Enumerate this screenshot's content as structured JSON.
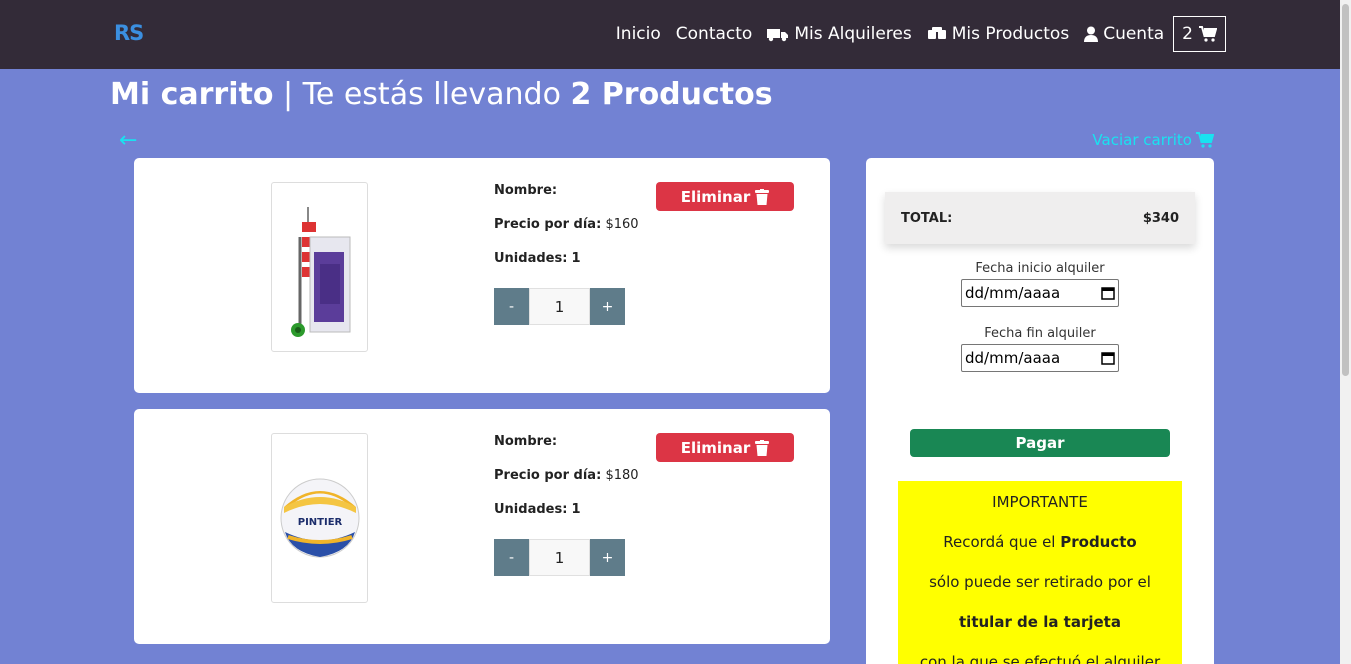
{
  "nav": {
    "brand": "RS",
    "links": [
      "Inicio",
      "Contacto",
      "Mis Alquileres",
      "Mis Productos",
      "Cuenta"
    ],
    "cart_count": "2"
  },
  "title": {
    "main": "Mi carrito",
    "separator": " | ",
    "middle": "Te estás llevando ",
    "count": "2 Productos"
  },
  "clear_cart_label": "Vaciar carrito",
  "back_arrow": "←",
  "labels": {
    "name": "Nombre:",
    "price": "Precio por día:",
    "units": "Unidades:",
    "delete": "Eliminar",
    "minus": "-",
    "plus": "+"
  },
  "items": [
    {
      "name": "",
      "price": "$160",
      "units": "1",
      "qty": "1",
      "image": "beach-cart-icon"
    },
    {
      "name": "",
      "price": "$180",
      "units": "1",
      "qty": "1",
      "image": "volleyball-icon"
    }
  ],
  "summary": {
    "total_label": "TOTAL:",
    "total_value": "$340",
    "start_label": "Fecha inicio alquiler",
    "end_label": "Fecha fin alquiler",
    "date_placeholder": "dd/mm/aaaa",
    "pay_label": "Pagar"
  },
  "notice": {
    "title": "IMPORTANTE",
    "line1_a": "Recordá que el ",
    "line1_b": "Producto",
    "line2": "sólo puede ser retirado por el",
    "line3": "titular de la tarjeta",
    "line4": "con la que se efectuó el alquiler"
  },
  "colors": {
    "background": "#7282d3",
    "navbar": "#332b38",
    "accent": "#19e2f0",
    "danger": "#dc3545",
    "success": "#198754",
    "notice": "#ffff00"
  }
}
